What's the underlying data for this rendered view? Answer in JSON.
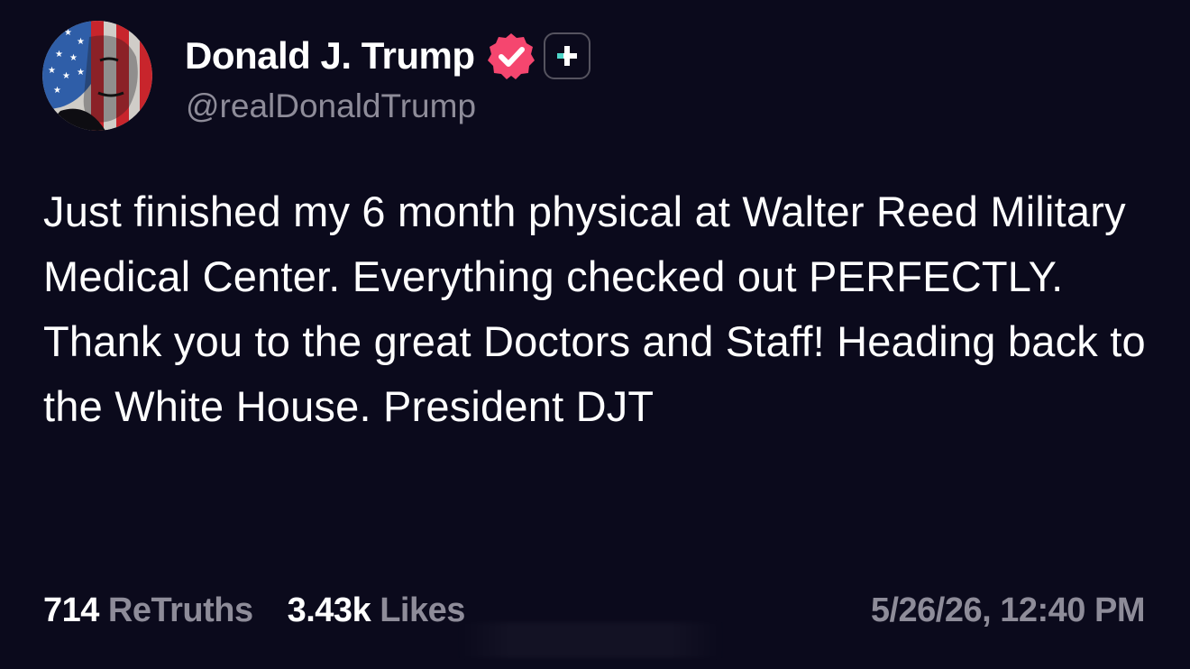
{
  "post": {
    "author": {
      "display_name": "Donald J. Trump",
      "handle": "@realDonaldTrump",
      "verified_icon": "verified-badge-icon",
      "plus_icon": "plus-badge-icon",
      "avatar_description": "avatar"
    },
    "body": "Just finished my 6 month physical at Walter Reed Military Medical Center. Everything checked out PERFECTLY. Thank you to the great Doctors and Staff! Heading back to the White House. President DJT",
    "stats": {
      "retruths_count": "714",
      "retruths_label": "ReTruths",
      "likes_count": "3.43k",
      "likes_label": "Likes"
    },
    "timestamp": "5/26/26, 12:40 PM"
  },
  "colors": {
    "background": "#0b0a1c",
    "text_primary": "#ffffff",
    "text_secondary": "#8e8c99",
    "verified": "#f5466f",
    "plus_accent": "#4fd6c9"
  }
}
